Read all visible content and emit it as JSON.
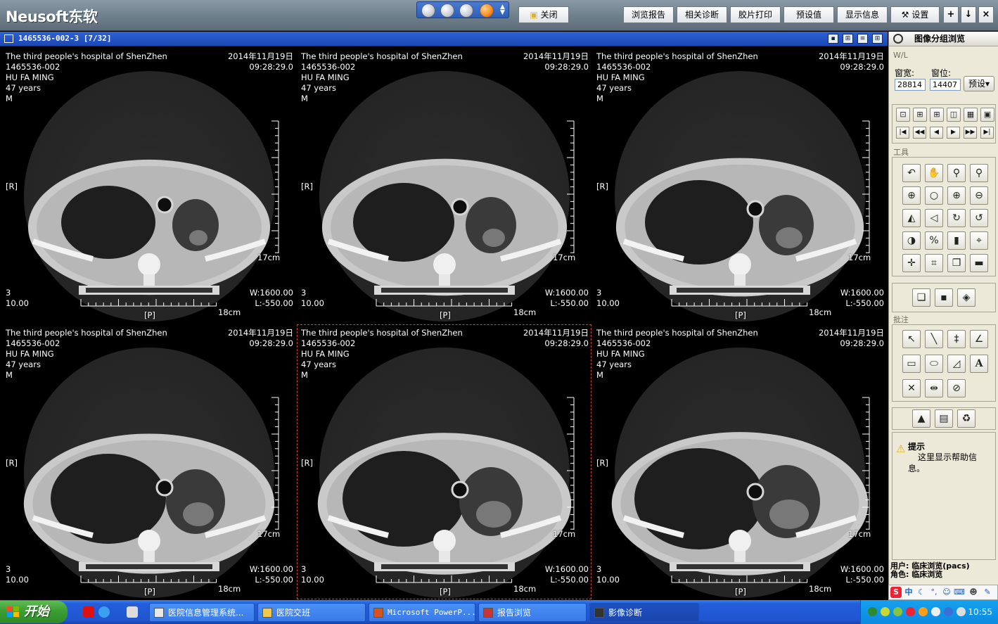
{
  "app": {
    "logo_text": "Neusoft东软",
    "close_label": "关闭",
    "toolbar": [
      "浏览报告",
      "相关诊断",
      "胶片打印",
      "预设值",
      "显示信息",
      "设置"
    ],
    "window_controls": [
      "+",
      "↓",
      "×"
    ]
  },
  "viewer": {
    "series_title": "1465536-002-3 [7/32]"
  },
  "images": [
    {
      "hospital": "The third people's hospital of ShenZhen",
      "pid": "1465536-002",
      "name": "HU FA MING",
      "age": "47 years",
      "sex": "M",
      "date": "2014年11月19日",
      "time": "09:28:29.0",
      "series": "3",
      "thickness": "10.00",
      "window_w": "W:1600.00",
      "window_l": "L:-550.00",
      "orient_r": "[R]",
      "orient_p": "[P]",
      "ruler_v": "17cm",
      "ruler_h": "18cm",
      "active": false,
      "level": 1
    },
    {
      "hospital": "The third people's hospital of ShenZhen",
      "pid": "1465536-002",
      "name": "HU FA MING",
      "age": "47 years",
      "sex": "M",
      "date": "2014年11月19日",
      "time": "09:28:29.0",
      "series": "3",
      "thickness": "10.00",
      "window_w": "W:1600.00",
      "window_l": "L:-550.00",
      "orient_r": "[R]",
      "orient_p": "[P]",
      "ruler_v": "17cm",
      "ruler_h": "18cm",
      "active": false,
      "level": 2
    },
    {
      "hospital": "The third people's hospital of ShenZhen",
      "pid": "1465536-002",
      "name": "HU FA MING",
      "age": "47 years",
      "sex": "M",
      "date": "2014年11月19日",
      "time": "09:28:29.0",
      "series": "3",
      "thickness": "10.00",
      "window_w": "W:1600.00",
      "window_l": "L:-550.00",
      "orient_r": "[R]",
      "orient_p": "[P]",
      "ruler_v": "17cm",
      "ruler_h": "18cm",
      "active": false,
      "level": 3
    },
    {
      "hospital": "The third people's hospital of ShenZhen",
      "pid": "1465536-002",
      "name": "HU FA MING",
      "age": "47 years",
      "sex": "M",
      "date": "2014年11月19日",
      "time": "09:28:29.0",
      "series": "3",
      "thickness": "10.00",
      "window_w": "W:1600.00",
      "window_l": "L:-550.00",
      "orient_r": "[R]",
      "orient_p": "[P]",
      "ruler_v": "17cm",
      "ruler_h": "18cm",
      "active": false,
      "level": 4
    },
    {
      "hospital": "The third people's hospital of ShenZhen",
      "pid": "1465536-002",
      "name": "HU FA MING",
      "age": "47 years",
      "sex": "M",
      "date": "2014年11月19日",
      "time": "09:28:29.0",
      "series": "3",
      "thickness": "10.00",
      "window_w": "W:1600.00",
      "window_l": "L:-550.00",
      "orient_r": "[R]",
      "orient_p": "[P]",
      "ruler_v": "17cm",
      "ruler_h": "18cm",
      "active": true,
      "level": 5
    },
    {
      "hospital": "The third people's hospital of ShenZhen",
      "pid": "1465536-002",
      "name": "HU FA MING",
      "age": "47 years",
      "sex": "M",
      "date": "2014年11月19日",
      "time": "09:28:29.0",
      "series": "3",
      "thickness": "10.00",
      "window_w": "W:1600.00",
      "window_l": "L:-550.00",
      "orient_r": "[R]",
      "orient_p": "[P]",
      "ruler_v": "17cm",
      "ruler_h": "18cm",
      "active": false,
      "level": 6
    }
  ],
  "panel": {
    "title": "图像分组浏览",
    "wl_label": "W/L",
    "width_label": "窗宽:",
    "level_label": "窗位:",
    "width_value": "28814",
    "level_value": "14407",
    "preset_label": "预设",
    "tools_label": "工具",
    "annot_label": "批注",
    "hint_title": "提示",
    "hint_text": "这里显示帮助信息。",
    "user_line": "用户: 临床浏览(pacs)",
    "role_line": "角色: 临床浏览"
  },
  "taskbar": {
    "start_label": "开始",
    "tasks": [
      "医院信息管理系统...",
      "医院交班",
      "Microsoft PowerP...",
      "报告浏览",
      "影像诊断"
    ],
    "clock": "10:55"
  },
  "colors": {
    "header_blue": "#2f62d6",
    "active_border": "#d2412a",
    "panel_bg": "#ece9d8",
    "taskbar_blue": "#245edb"
  }
}
